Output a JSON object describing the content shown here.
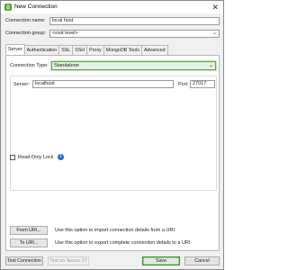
{
  "window": {
    "title": "New Connection",
    "close_glyph": "✕"
  },
  "form": {
    "connection_name_label": "Connection name:",
    "connection_name_value": "local host",
    "connection_group_label": "Connection group:",
    "connection_group_value": "<root level>"
  },
  "tabs": [
    {
      "label": "Server",
      "active": true
    },
    {
      "label": "Authentication"
    },
    {
      "label": "SSL"
    },
    {
      "label": "SSH"
    },
    {
      "label": "Proxy"
    },
    {
      "label": "MongoDB Tools"
    },
    {
      "label": "Advanced"
    }
  ],
  "server": {
    "connection_type_label": "Connection Type:",
    "connection_type_value": "Standalone",
    "server_label": "Server:",
    "server_value": "localhost",
    "port_label": "Port:",
    "port_value": "27017",
    "readonly_label": "Read-Only Lock",
    "info_glyph": "i"
  },
  "uri": {
    "from_label": "From URI...",
    "from_desc": "Use this option to import connection details from a URI",
    "to_label": "To URI...",
    "to_desc": "Use this option to export complete connection details to a URI"
  },
  "footer": {
    "test_connection": "Test Connection",
    "test_on_server": "Test on Server 3T",
    "save": "Save",
    "cancel": "Cancel"
  },
  "colors": {
    "accent": "#5fa34b",
    "info": "#1e6fd9"
  },
  "icons": {
    "app": "studio-3t-app-icon",
    "chevron": "chevron-down-icon"
  }
}
